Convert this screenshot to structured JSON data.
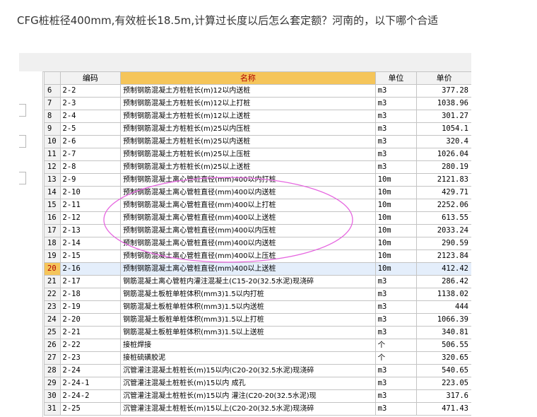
{
  "question": "CFG桩桩径400mm,有效桩长18.5m,计算过长度以后怎么套定额？河南的，以下哪个合适",
  "table": {
    "headers": {
      "code": "编码",
      "name": "名称",
      "unit": "单位",
      "price": "单价"
    },
    "selected_row": "20",
    "rows": [
      {
        "n": "6",
        "code": "2-2",
        "name": "预制钢筋混凝土方桩桩长(m)12以内送桩",
        "unit": "m3",
        "price": "377.28"
      },
      {
        "n": "7",
        "code": "2-3",
        "name": "预制钢筋混凝土方桩桩长(m)12以上打桩",
        "unit": "m3",
        "price": "1038.96"
      },
      {
        "n": "8",
        "code": "2-4",
        "name": "预制钢筋混凝土方桩桩长(m)12以上送桩",
        "unit": "m3",
        "price": "301.27"
      },
      {
        "n": "9",
        "code": "2-5",
        "name": "预制钢筋混凝土方桩桩长(m)25以内压桩",
        "unit": "m3",
        "price": "1054.1"
      },
      {
        "n": "10",
        "code": "2-6",
        "name": "预制钢筋混凝土方桩桩长(m)25以内送桩",
        "unit": "m3",
        "price": "320.4"
      },
      {
        "n": "11",
        "code": "2-7",
        "name": "预制钢筋混凝土方桩桩长(m)25以上压桩",
        "unit": "m3",
        "price": "1026.04"
      },
      {
        "n": "12",
        "code": "2-8",
        "name": "预制钢筋混凝土方桩桩长(m)25以上送桩",
        "unit": "m3",
        "price": "280.19"
      },
      {
        "n": "13",
        "code": "2-9",
        "name": "预制钢筋混凝土离心管桩直径(mm)400以内打桩",
        "unit": "10m",
        "price": "2121.83"
      },
      {
        "n": "14",
        "code": "2-10",
        "name": "预制钢筋混凝土离心管桩直径(mm)400以内送桩",
        "unit": "10m",
        "price": "429.71"
      },
      {
        "n": "15",
        "code": "2-11",
        "name": "预制钢筋混凝土离心管桩直径(mm)400以上打桩",
        "unit": "10m",
        "price": "2252.06"
      },
      {
        "n": "16",
        "code": "2-12",
        "name": "预制钢筋混凝土离心管桩直径(mm)400以上送桩",
        "unit": "10m",
        "price": "613.55"
      },
      {
        "n": "17",
        "code": "2-13",
        "name": "预制钢筋混凝土离心管桩直径(mm)400以内压桩",
        "unit": "10m",
        "price": "2033.24"
      },
      {
        "n": "18",
        "code": "2-14",
        "name": "预制钢筋混凝土离心管桩直径(mm)400以内送桩",
        "unit": "10m",
        "price": "290.59"
      },
      {
        "n": "19",
        "code": "2-15",
        "name": "预制钢筋混凝土离心管桩直径(mm)400以上压桩",
        "unit": "10m",
        "price": "2123.84"
      },
      {
        "n": "20",
        "code": "2-16",
        "name": "预制钢筋混凝土离心管桩直径(mm)400以上送桩",
        "unit": "10m",
        "price": "412.42"
      },
      {
        "n": "21",
        "code": "2-17",
        "name": "钢筋混凝土离心管桩内灌注混凝土(C15-20(32.5水泥)现浇碎",
        "unit": "m3",
        "price": "286.42"
      },
      {
        "n": "22",
        "code": "2-18",
        "name": "钢筋混凝土板桩单桩体积(mm3)1.5以内打桩",
        "unit": "m3",
        "price": "1138.02"
      },
      {
        "n": "23",
        "code": "2-19",
        "name": "钢筋混凝土板桩单桩体积(mm3)1.5以内送桩",
        "unit": "m3",
        "price": "444"
      },
      {
        "n": "24",
        "code": "2-20",
        "name": "钢筋混凝土板桩单桩体积(mm3)1.5以上打桩",
        "unit": "m3",
        "price": "1066.39"
      },
      {
        "n": "25",
        "code": "2-21",
        "name": "钢筋混凝土板桩单桩体积(mm3)1.5以上送桩",
        "unit": "m3",
        "price": "340.81"
      },
      {
        "n": "26",
        "code": "2-22",
        "name": "接桩焊接",
        "unit": "个",
        "price": "506.55"
      },
      {
        "n": "27",
        "code": "2-23",
        "name": "接桩硫磺胶泥",
        "unit": "个",
        "price": "320.65"
      },
      {
        "n": "28",
        "code": "2-24",
        "name": "沉管灌注混凝土桩桩长(m)15以内(C20-20(32.5水泥)现浇碎",
        "unit": "m3",
        "price": "540.65"
      },
      {
        "n": "29",
        "code": "2-24-1",
        "name": "沉管灌注混凝土桩桩长(m)15以内 成孔",
        "unit": "m3",
        "price": "223.05"
      },
      {
        "n": "30",
        "code": "2-24-2",
        "name": "沉管灌注混凝土桩桩长(m)15以内 灌注(C20-20(32.5水泥)现",
        "unit": "m3",
        "price": "317.6"
      },
      {
        "n": "31",
        "code": "2-25",
        "name": "沉管灌注混凝土桩桩长(m)15以上(C20-20(32.5水泥)现浇碎",
        "unit": "m3",
        "price": "471.43"
      }
    ]
  },
  "annotation_color": "#e667e0",
  "selection_color": "#f5c55a"
}
